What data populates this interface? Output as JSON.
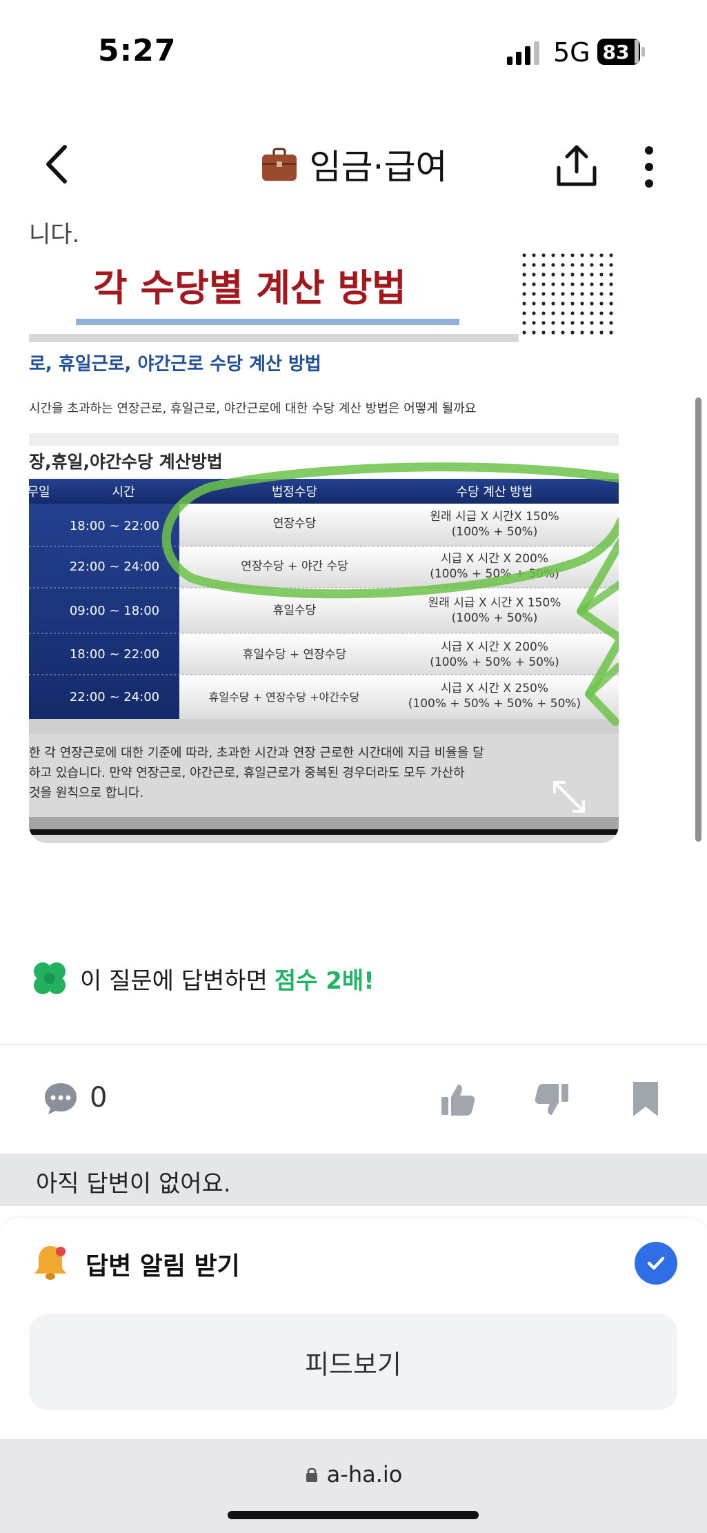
{
  "status_bar": {
    "time": "5:27",
    "network": "5G",
    "battery": "83"
  },
  "header": {
    "title": "임금·급여"
  },
  "article": {
    "truncated_text": "니다.",
    "image": {
      "title": "각 수당별 계산 방법",
      "subtitle": "로, 휴일근로, 야간근로 수당 계산 방법",
      "intro": "시간을 초과하는 연장근로, 휴일근로, 야간근로에 대한 수당 계산 방법은 어떻게 될까요",
      "section": "장,휴일,야간수당 계산방법",
      "table": {
        "headers": [
          "무일",
          "시간",
          "법정수당",
          "수당 계산 방법"
        ],
        "rows": [
          {
            "time": "18:00 ~ 22:00",
            "allowance": "연장수당",
            "calc1": "원래 시급 X 시간X 150%",
            "calc2": "(100% + 50%)"
          },
          {
            "time": "22:00 ~ 24:00",
            "allowance": "연장수당 + 야간 수당",
            "calc1": "시급 X 시간 X 200%",
            "calc2": "(100% + 50% + 50%)"
          },
          {
            "time": "09:00 ~ 18:00",
            "allowance": "휴일수당",
            "calc1": "원래 시급 X 시간 X 150%",
            "calc2": "(100% + 50%)"
          },
          {
            "time": "18:00 ~ 22:00",
            "allowance": "휴일수당 + 연장수당",
            "calc1": "시급 X 시간 X 200%",
            "calc2": "(100% + 50% + 50%)"
          },
          {
            "time": "22:00 ~ 24:00",
            "allowance": "휴일수당 + 연장수당 +야간수당",
            "calc1": "시급 X 시간 X 250%",
            "calc2": "(100% + 50% + 50% + 50%)"
          }
        ]
      },
      "footer_lines": [
        "한 각 연장근로에 대한 기준에 따라, 초과한 시간과 연장 근로한 시간대에 지급 비율을 달",
        "하고 있습니다. 만약 연장근로, 야간근로, 휴일근로가 중복된 경우더라도 모두 가산하",
        "것을 원칙으로 합니다."
      ]
    }
  },
  "promo": {
    "text": "이 질문에 답변하면",
    "highlight": "점수 2배!"
  },
  "actions": {
    "comment_count": "0"
  },
  "no_answer": "아직 답변이 없어요.",
  "notify": {
    "label": "답변 알림 받기",
    "checked": true
  },
  "feed_button": "피드보기",
  "browser": {
    "url": "a-ha.io"
  },
  "colors": {
    "accent_blue": "#2f6ee7",
    "promo_green": "#1fb464",
    "image_title_red": "#a3181c",
    "table_navy": "#1f3a86"
  }
}
